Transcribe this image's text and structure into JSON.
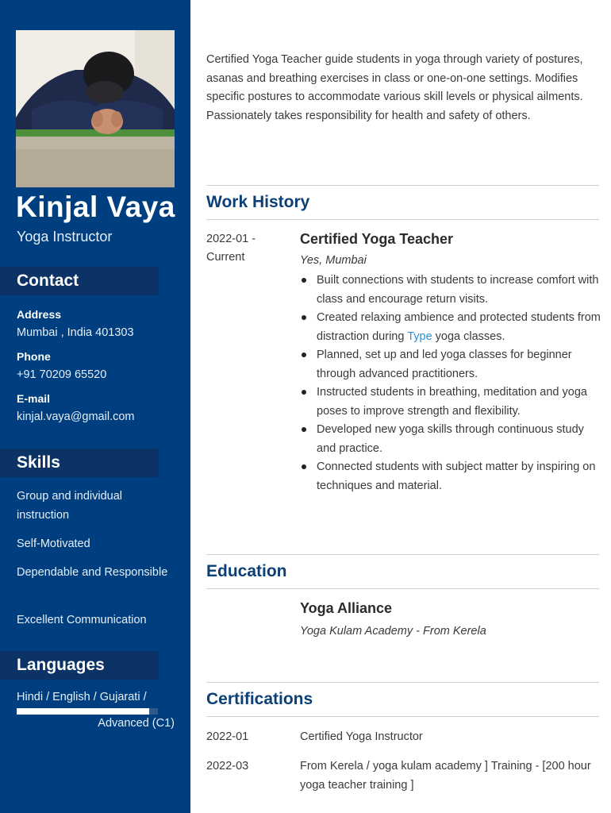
{
  "profile": {
    "name": "Kinjal Vaya",
    "title": "Yoga Instructor",
    "photo": "yoga-pose-photo"
  },
  "contact": {
    "heading": "Contact",
    "address_label": "Address",
    "address": "Mumbai , India 401303",
    "phone_label": "Phone",
    "phone": "+91 70209 65520",
    "email_label": "E-mail",
    "email": "kinjal.vaya@gmail.com"
  },
  "skills": {
    "heading": "Skills",
    "items": [
      "Group and individual instruction",
      "Self-Motivated",
      "Dependable and Responsible",
      "Excellent Communication"
    ]
  },
  "languages": {
    "heading": "Languages",
    "items": [
      {
        "name": "Hindi / English / Gujarati /",
        "level": "Advanced (C1)",
        "proficiency": 0.94
      }
    ]
  },
  "summary": "Certified Yoga Teacher guide students in yoga through variety of postures, asanas and breathing exercises in class or one-on-one settings. Modifies specific postures to accommodate various skill levels or physical ailments. Passionately takes responsibility for health and safety of others.",
  "work_history": {
    "heading": "Work History",
    "jobs": [
      {
        "date_start": "2022-01 -",
        "date_end": "Current",
        "title": "Certified Yoga Teacher",
        "company": "Yes, Mumbai",
        "bullets": [
          "Built connections with students to increase comfort with class and encourage return visits.",
          "Created relaxing ambience and protected students from distraction during",
          "Planned, set up and led yoga classes for beginner through advanced practitioners.",
          "Instructed students in breathing, meditation and yoga poses to improve strength and flexibility.",
          "Developed new yoga skills through continuous study and practice.",
          "Connected students with subject matter by inspiring on techniques and material."
        ],
        "bullet2_link": "Type",
        "bullet2_tail": "yoga classes."
      }
    ]
  },
  "education": {
    "heading": "Education",
    "items": [
      {
        "school": "Yoga Alliance",
        "detail": "Yoga Kulam Academy - From Kerela"
      }
    ]
  },
  "certifications": {
    "heading": "Certifications",
    "items": [
      {
        "date": "2022-01",
        "text": "Certified Yoga Instructor"
      },
      {
        "date": "2022-03",
        "text": "From Kerela / yoga kulam academy ] Training - [200 hour yoga teacher training ]"
      }
    ]
  },
  "colors": {
    "sidebar": "#003f7f",
    "section_header_bg": "#0b3366",
    "heading_text": "#0b3f75",
    "link": "#2f8fcf"
  }
}
